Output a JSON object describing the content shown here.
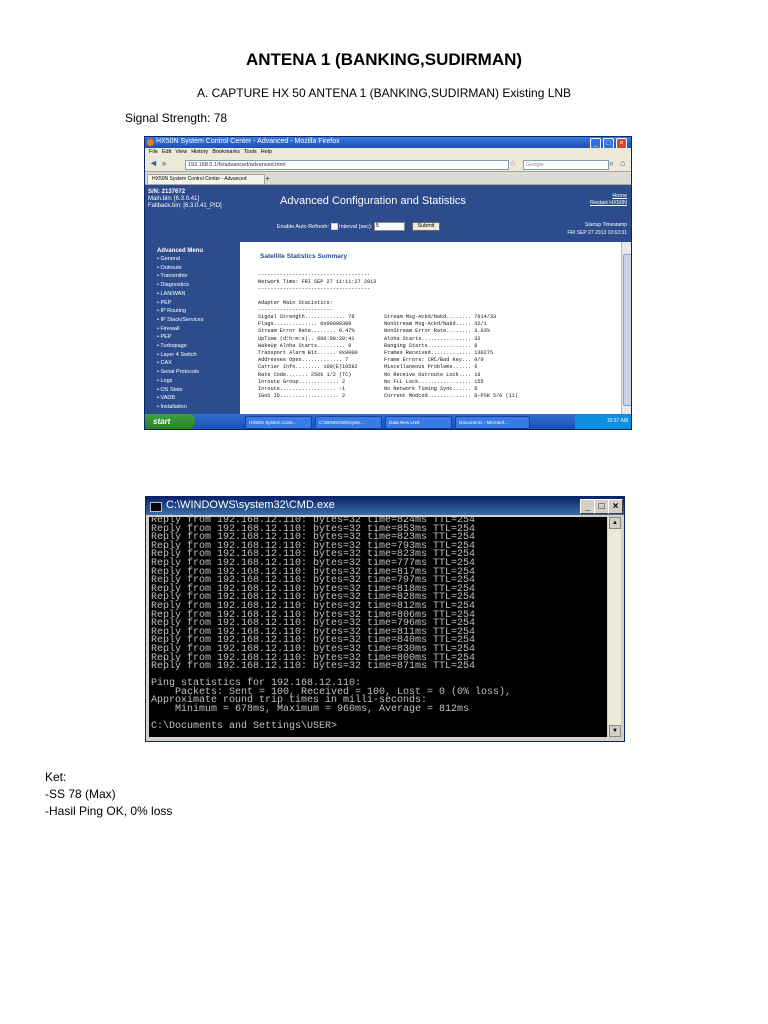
{
  "doc": {
    "title": "ANTENA 1 (BANKING,SUDIRMAN)",
    "subtitle": "A. CAPTURE HX 50 ANTENA 1 (BANKING,SUDIRMAN) Existing LNB",
    "signal_label": "Signal Strength: 78"
  },
  "browser": {
    "window_title": "HX50N System Control Center - Advanced - Mozilla Firefox",
    "menu": [
      "File",
      "Edit",
      "View",
      "History",
      "Bookmarks",
      "Tools",
      "Help"
    ],
    "url": "192.168.0.1/fs/advanced/advanced.html",
    "search_placeholder": "Google",
    "tab_label": "HX50N System Control Center - Advanced",
    "new_tab": "+"
  },
  "hx": {
    "sn": "S/N: 2137672",
    "main_bin": "Main.bin: [6.3.0.41]",
    "fallback_bin": "Fallback.bin: [6.3.0.41_PID]",
    "heading": "Advanced Configuration and Statistics",
    "home": "Home",
    "restart": "Restart HX50N",
    "auto_refresh": "Enable Auto Refresh:",
    "interval_label": "Interval (sec):",
    "interval_value": "5",
    "submit": "Submit",
    "timestamp_label": "Startup Timestamp",
    "timestamp": "FRI SEP 27 2013 10:63:31",
    "menu_title": "Advanced Menu",
    "menu_items": [
      "General",
      "Outroute",
      "Transmitter",
      "Diagnostics",
      "LAN/WAN",
      "PEP",
      "IP Routing",
      "IP Stack/Services",
      "Firewall",
      "PEP",
      "Turbopage",
      "Layer 4 Switch",
      "CAX",
      "Serial Protocols",
      "Logs",
      "OS Stats",
      "VADB",
      "Installation"
    ],
    "stats_title": "Satellite Statistics Summary",
    "separator": "------------------------------------",
    "network_time": "Network Time: FRI SEP 27 11:11:27 2013",
    "adapter_title": "Adapter Main Statistics:",
    "separator_short": "------------------------",
    "stats_left": "Signal Strength............. 78\nFlags.............. 0x00000300\nStream Error Rate........ 0.47%\nUpTime (d:h:m:s).. 000:00:20:41\nWakeUp Aloha Starts......... 0\nTransport Alarm Bit...... 0x0000\nAddresses Open............. 7\nCarrier Info........ 100(E)10592\nRate Code....... 256k 1/2 (TC)\nInroute Group............. 2\nInroute.................. -1\nIGoS ID................... 2",
    "stats_right": "Stream Msg-Ackd/Nakd........ 7014/33\nNonStream Msg-Ackd/Nakd..... 32/1\nNonStream Error Rate........ 3.03%\nAloha Starts................ 32\nRanging Starts.............. 8\nFrames Received............. 130275\nFrame Errors: CRC/Bad Key... 0/0\nMiscellaneous Problems...... 6\nNo Receive Outroute Lock.... 16\nNo FLL Lock................. 155\nNo Network Timing Sync...... 6\nCurrent Modcod.............. 8-PSK 5/6 (11)"
  },
  "taskbar": {
    "start": "start",
    "items": [
      "HX50N System Contr...",
      "C:\\WINDOWS\\syste...",
      "Data New LNB",
      "Document1 - Microsof..."
    ],
    "clock": "10:37 AM"
  },
  "cmd": {
    "title": "C:\\WINDOWS\\system32\\CMD.exe",
    "output": "Reply from 192.168.12.110: bytes=32 time=824ms TTL=254\nReply from 192.168.12.110: bytes=32 time=853ms TTL=254\nReply from 192.168.12.110: bytes=32 time=823ms TTL=254\nReply from 192.168.12.110: bytes=32 time=793ms TTL=254\nReply from 192.168.12.110: bytes=32 time=823ms TTL=254\nReply from 192.168.12.110: bytes=32 time=777ms TTL=254\nReply from 192.168.12.110: bytes=32 time=817ms TTL=254\nReply from 192.168.12.110: bytes=32 time=797ms TTL=254\nReply from 192.168.12.110: bytes=32 time=818ms TTL=254\nReply from 192.168.12.110: bytes=32 time=828ms TTL=254\nReply from 192.168.12.110: bytes=32 time=812ms TTL=254\nReply from 192.168.12.110: bytes=32 time=806ms TTL=254\nReply from 192.168.12.110: bytes=32 time=796ms TTL=254\nReply from 192.168.12.110: bytes=32 time=811ms TTL=254\nReply from 192.168.12.110: bytes=32 time=840ms TTL=254\nReply from 192.168.12.110: bytes=32 time=830ms TTL=254\nReply from 192.168.12.110: bytes=32 time=800ms TTL=254\nReply from 192.168.12.110: bytes=32 time=871ms TTL=254\n\nPing statistics for 192.168.12.110:\n    Packets: Sent = 100, Received = 100, Lost = 0 (0% loss),\nApproximate round trip times in milli-seconds:\n    Minimum = 678ms, Maximum = 960ms, Average = 812ms\n\nC:\\Documents and Settings\\USER>"
  },
  "notes": {
    "heading": "Ket:",
    "line1": "-SS 78 (Max)",
    "line2": "-Hasil Ping OK, 0% loss"
  }
}
